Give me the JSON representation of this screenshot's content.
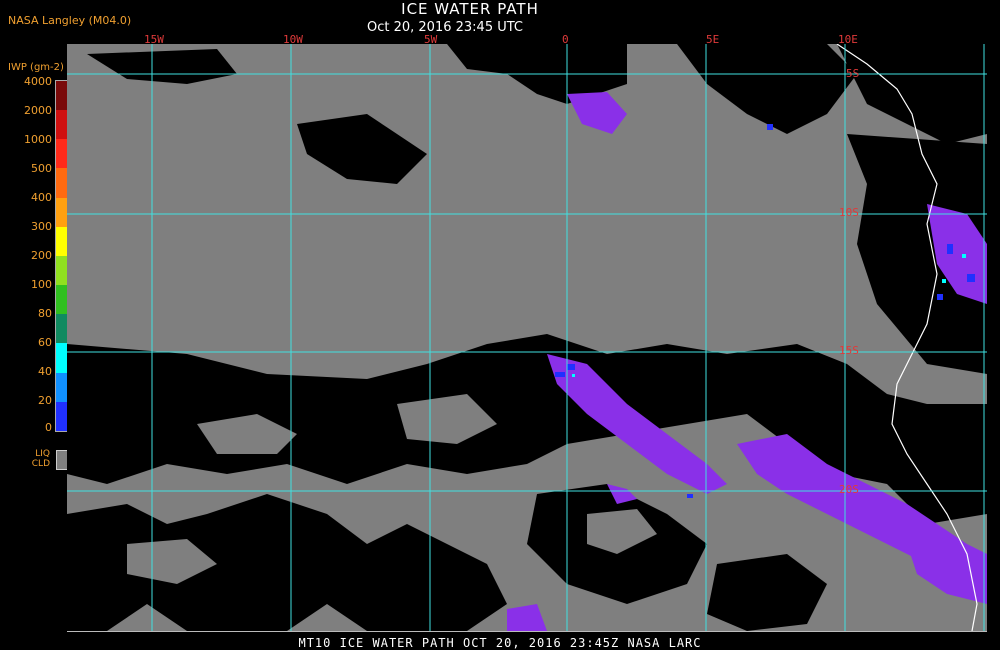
{
  "header": {
    "agency": "NASA Langley (M04.0)",
    "title": "ICE WATER PATH",
    "subtitle": "Oct 20, 2016 23:45 UTC"
  },
  "legend": {
    "title": "IWP (gm-2)",
    "values": [
      "4000",
      "2000",
      "1000",
      "500",
      "400",
      "300",
      "200",
      "100",
      "80",
      "60",
      "40",
      "20",
      "0"
    ],
    "colors": [
      "#7a0a0a",
      "#d01010",
      "#ff2a1a",
      "#ff6a10",
      "#ffa010",
      "#ffff00",
      "#90e020",
      "#30c020",
      "#108a60",
      "#00ffff",
      "#1090ff",
      "#2030ff",
      "#8a30e8"
    ],
    "liq_label": "LIQ CLD",
    "liq_color": "#7f7f7f"
  },
  "grid": {
    "lon_labels": [
      "15W",
      "10W",
      "5W",
      "0",
      "5E",
      "10E"
    ],
    "lat_labels": [
      "5S",
      "10S",
      "15S",
      "20S"
    ]
  },
  "footer": {
    "text": "MT10  ICE WATER PATH   OCT 20, 2016 23:45Z   NASA LARC"
  },
  "colors": {
    "liquid_cloud": "#7f7f7f",
    "clear": "#000000",
    "gridline": "#40e0e0",
    "coastline": "#ffffff",
    "ice": "#8a30e8"
  }
}
